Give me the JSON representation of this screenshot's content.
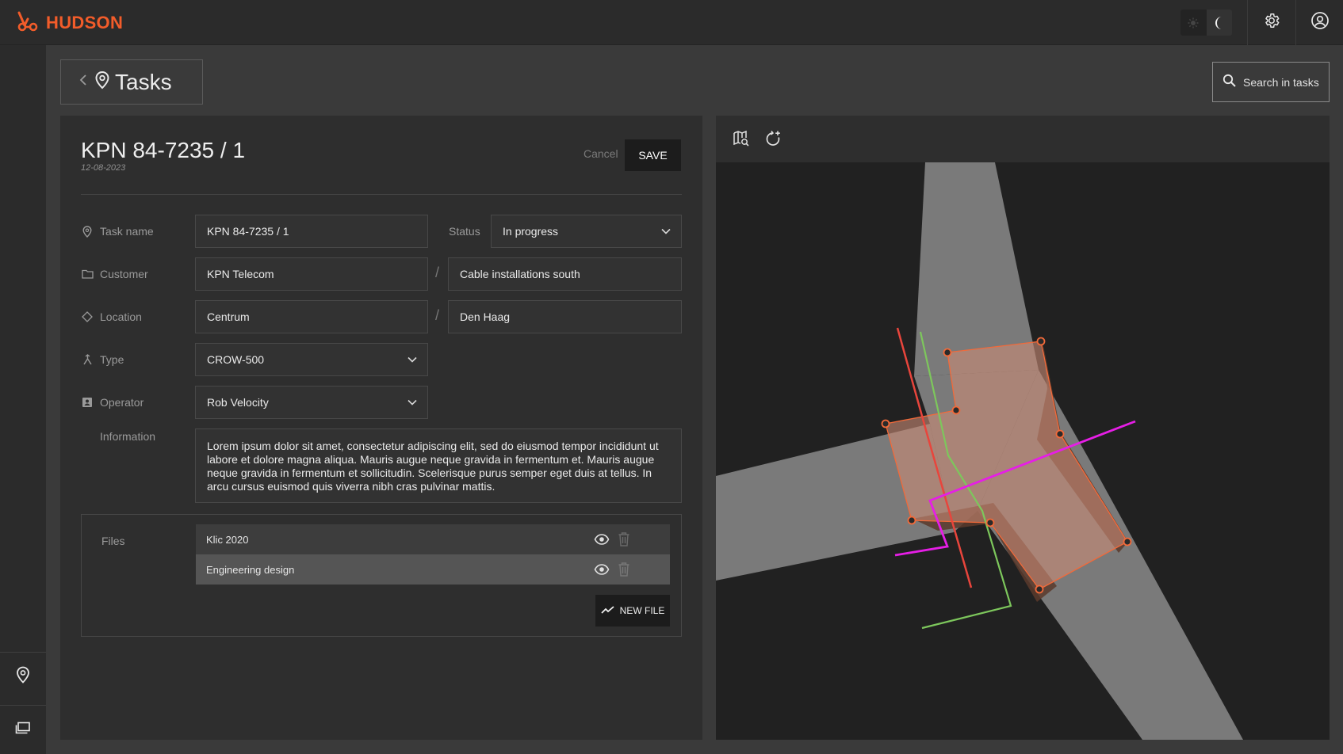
{
  "app": {
    "name": "HUDSON"
  },
  "header": {
    "title": "Tasks",
    "search_label": "Search in tasks"
  },
  "task": {
    "title": "KPN 84-7235 / 1",
    "date": "12-08-2023",
    "cancel_label": "Cancel",
    "save_label": "SAVE"
  },
  "form": {
    "task_name": {
      "label": "Task name",
      "value": "KPN 84-7235 / 1"
    },
    "status": {
      "label": "Status",
      "value": "In progress"
    },
    "customer": {
      "label": "Customer",
      "value": "KPN Telecom",
      "secondary": "Cable installations south"
    },
    "location": {
      "label": "Location",
      "value": "Centrum",
      "secondary": "Den Haag"
    },
    "type": {
      "label": "Type",
      "value": "CROW-500"
    },
    "operator": {
      "label": "Operator",
      "value": "Rob Velocity"
    },
    "information": {
      "label": "Information",
      "value": "Lorem ipsum dolor sit amet, consectetur adipiscing elit, sed do eiusmod tempor incididunt ut labore et dolore magna aliqua. Mauris augue neque gravida in fermentum et. Mauris augue neque gravida in fermentum et sollicitudin. Scelerisque purus semper eget duis at tellus. In arcu cursus euismod quis viverra nibh cras pulvinar mattis."
    },
    "separator": "/"
  },
  "files": {
    "label": "Files",
    "items": [
      {
        "name": "Klic 2020"
      },
      {
        "name": "Engineering design"
      }
    ],
    "new_file_label": "NEW FILE"
  },
  "colors": {
    "brand": "#f25c2a",
    "polygon_fill": "#c98a75",
    "polygon_stroke": "#f26a3a",
    "line_red": "#e8453c",
    "line_green": "#7dc75c",
    "line_magenta": "#e61ee6",
    "road": "#7a7a7a"
  },
  "icons": {
    "logo": "hudson-logo-icon",
    "sun": "sun-icon",
    "moon": "moon-icon",
    "settings": "gear-icon",
    "account": "account-circle-icon",
    "back": "chevron-left-icon",
    "map_pin": "map-pin-icon",
    "search": "search-icon",
    "map_search": "map-search-icon",
    "rotate": "rotate-add-icon",
    "eye": "eye-icon",
    "trash": "trash-icon",
    "trend": "trend-icon"
  }
}
